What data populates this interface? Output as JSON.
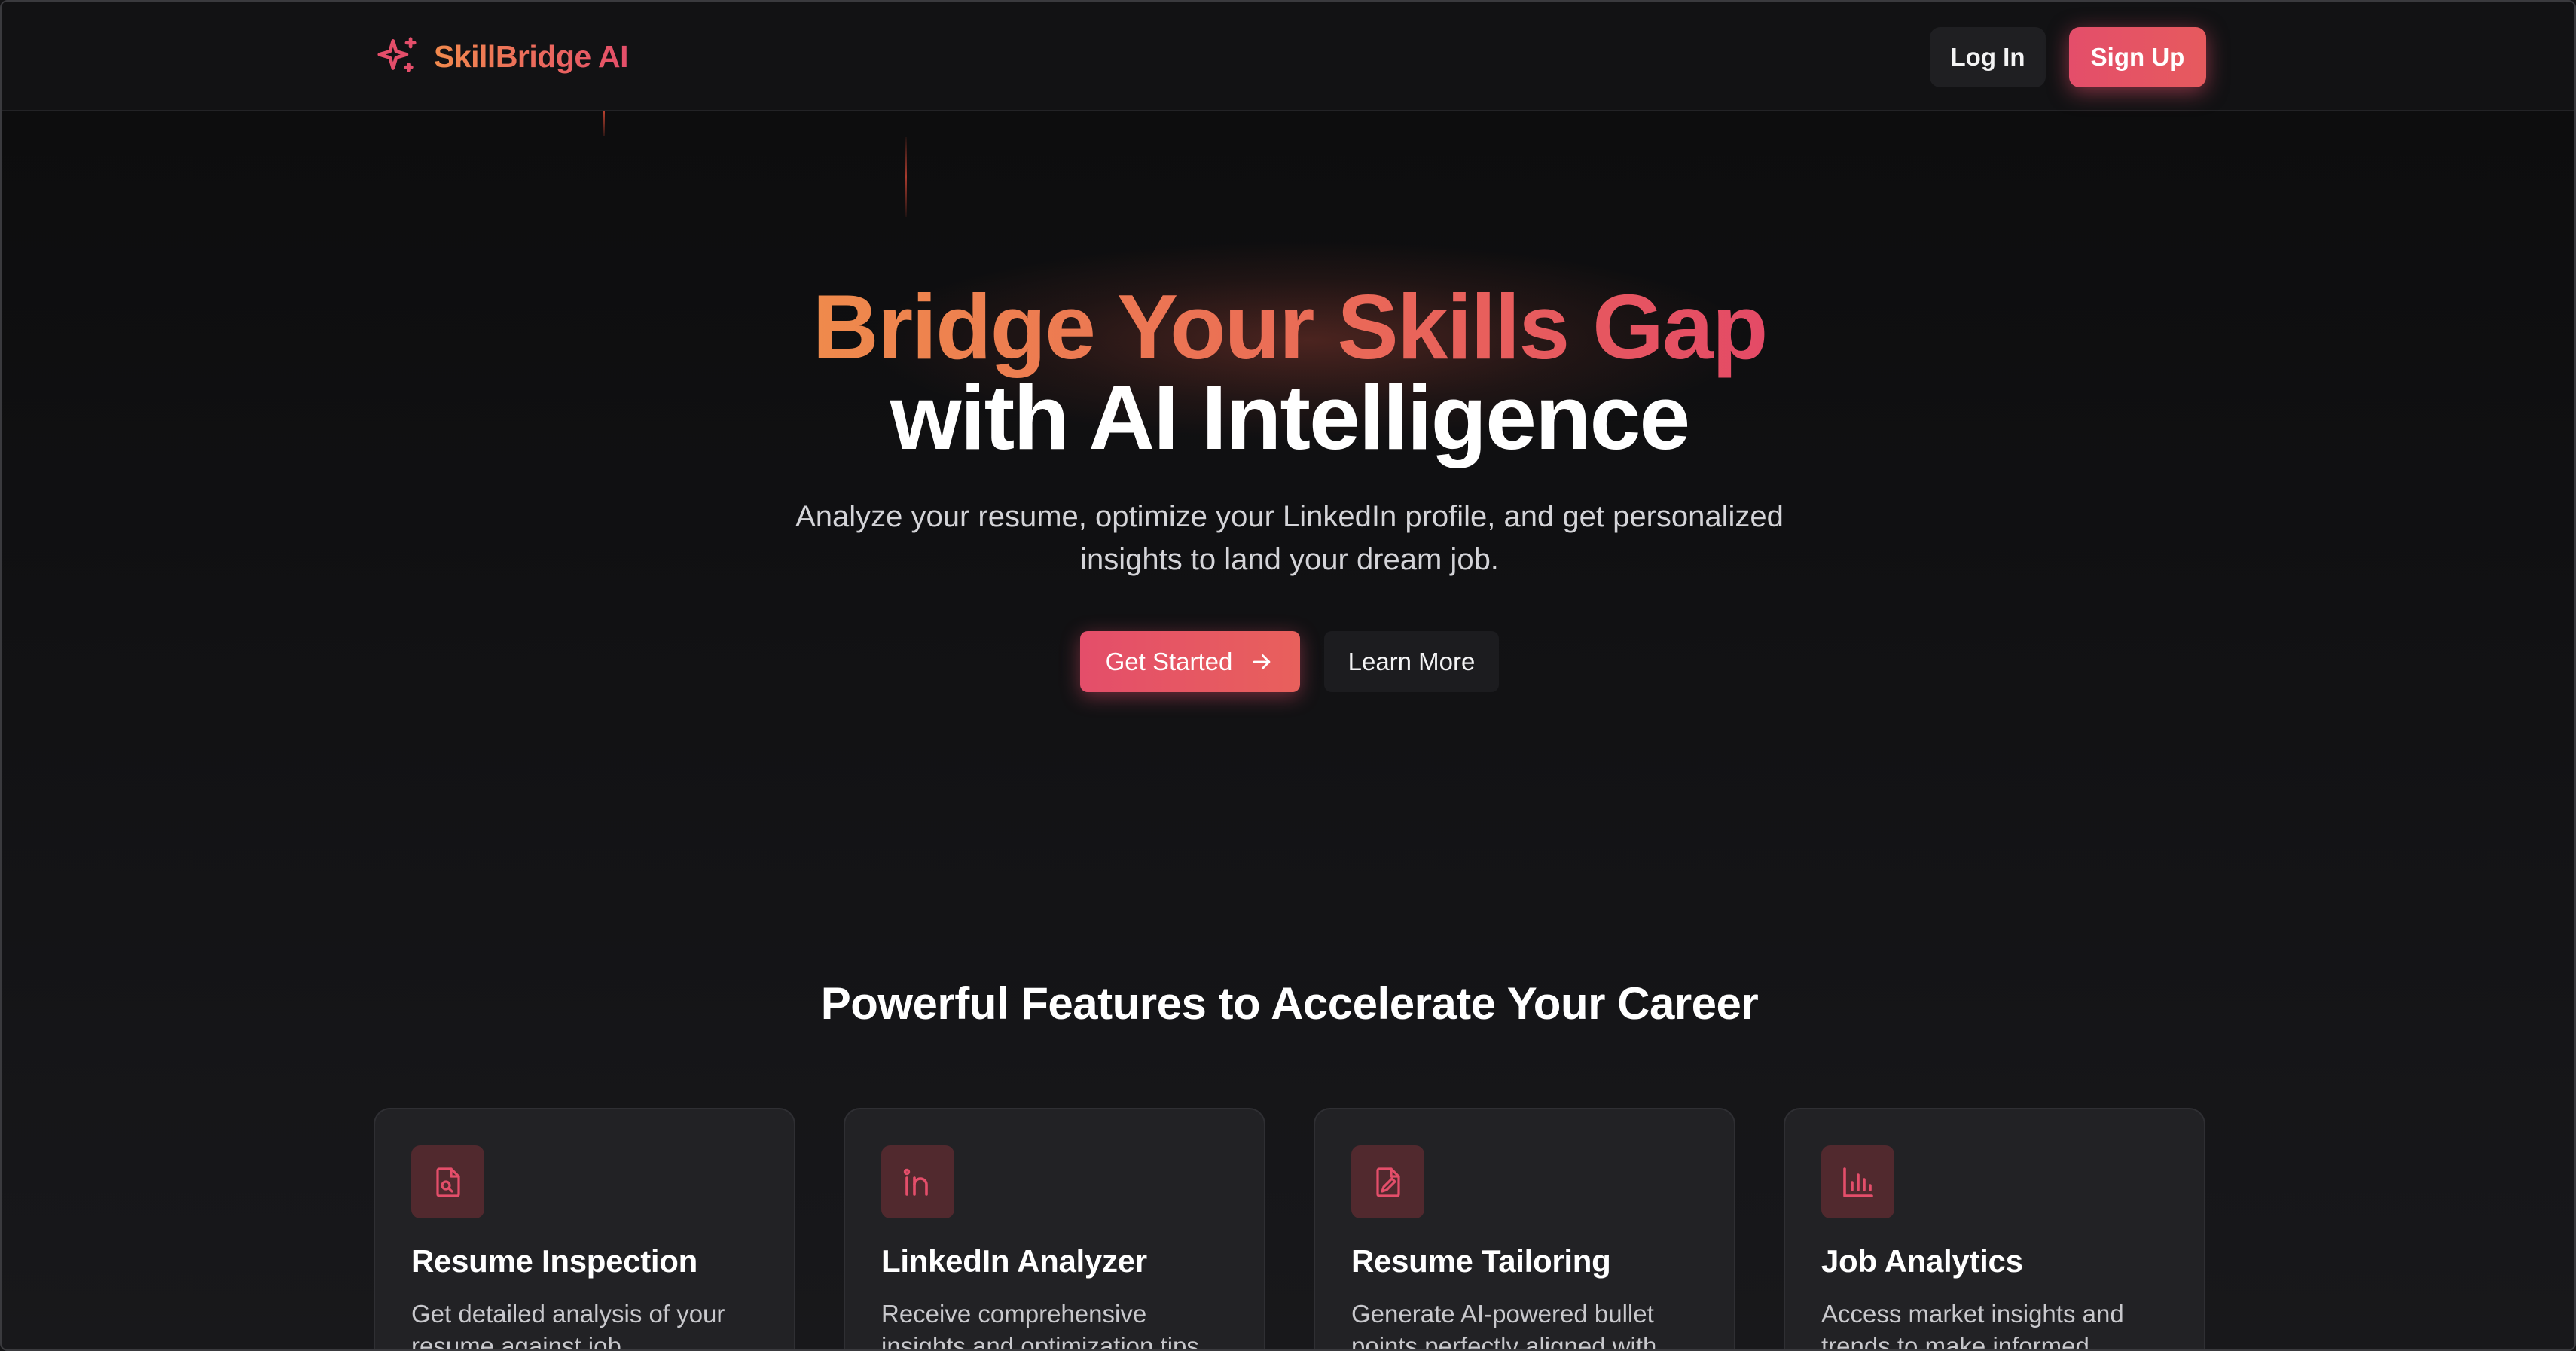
{
  "nav": {
    "brand_name": "SkillBridge AI",
    "brand_icon": "sparkles-icon",
    "login_label": "Log In",
    "signup_label": "Sign Up"
  },
  "hero": {
    "title_line1": "Bridge Your Skills Gap",
    "title_line2": "with AI Intelligence",
    "subtitle": "Analyze your resume, optimize your LinkedIn profile, and get personalized insights to land your dream job.",
    "primary_cta": "Get Started",
    "primary_cta_icon": "arrow-right-icon",
    "secondary_cta": "Learn More"
  },
  "features": {
    "heading": "Powerful Features to Accelerate Your Career",
    "items": [
      {
        "title": "Resume Inspection",
        "description": "Get detailed analysis of your resume against job",
        "icon": "file-search-icon"
      },
      {
        "title": "LinkedIn Analyzer",
        "description": "Receive comprehensive insights and optimization tips",
        "icon": "linkedin-icon"
      },
      {
        "title": "Resume Tailoring",
        "description": "Generate AI-powered bullet points perfectly aligned with",
        "icon": "file-edit-icon"
      },
      {
        "title": "Job Analytics",
        "description": "Access market insights and trends to make informed",
        "icon": "bar-chart-icon"
      }
    ]
  },
  "colors": {
    "background": "#141416",
    "accent": "#e44e6a",
    "accent_orange": "#ef8a4c",
    "card": "#222225",
    "icon_tile": "#51292e"
  }
}
